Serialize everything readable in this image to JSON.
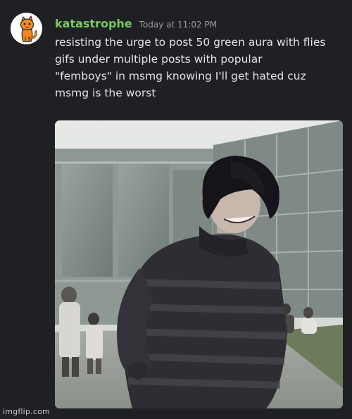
{
  "message": {
    "author": {
      "name": "katastrophe",
      "color": "#79c85c",
      "avatar_icon": "orange-cat-icon"
    },
    "timestamp": "Today at 11:02 PM",
    "text_lines": [
      "resisting the urge to post 50 green aura with flies",
      "gifs under multiple posts with popular",
      "\"femboys\" in msmg knowing I'll get hated cuz",
      "msmg is the worst"
    ],
    "attachment": {
      "type": "gif-still-image"
    }
  },
  "watermark": {
    "text": "imgflip.com"
  },
  "colors": {
    "background": "#1f2024",
    "username": "#79c85c",
    "timestamp": "#9a9ca3",
    "message_text": "#e3e4e8"
  }
}
